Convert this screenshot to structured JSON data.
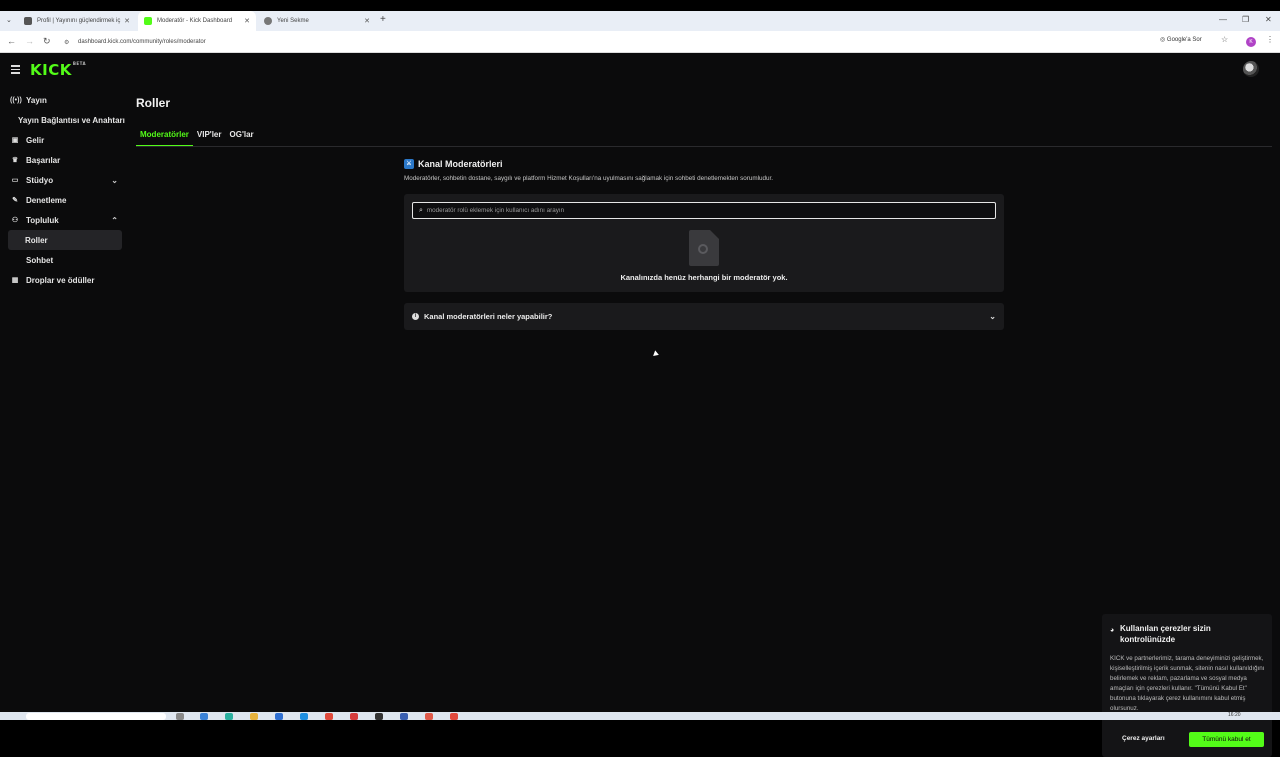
{
  "browser": {
    "tabs": [
      {
        "title": "Profil | Yayınını güçlendirmek iç",
        "fav_color": "#555555",
        "active": false
      },
      {
        "title": "Moderatör - Kick Dashboard",
        "fav_color": "#53fc18",
        "active": true
      },
      {
        "title": "Yeni Sekme",
        "fav_color": "#777777",
        "active": false
      }
    ],
    "url": "dashboard.kick.com/community/roles/moderator",
    "google_button": "Google'a Sor",
    "profile_initial": "K"
  },
  "app": {
    "logo": "KICK",
    "logo_badge": "BETA",
    "page_title": "Roller",
    "sidebar": [
      {
        "label": "Yayın",
        "icon": "broadcast-icon",
        "glyph": "((•))"
      },
      {
        "label": "Yayın Bağlantısı ve Anahtarı",
        "sub": true
      },
      {
        "label": "Gelir",
        "icon": "wallet-icon",
        "glyph": "▣"
      },
      {
        "label": "Başarılar",
        "icon": "trophy-icon",
        "glyph": "♛"
      },
      {
        "label": "Stüdyo",
        "icon": "studio-icon",
        "glyph": "▭",
        "chevron": "⌄"
      },
      {
        "label": "Denetleme",
        "icon": "wrench-icon",
        "glyph": "✎"
      },
      {
        "label": "Topluluk",
        "icon": "community-icon",
        "glyph": "⚇",
        "chevron": "⌃"
      },
      {
        "label": "Roller",
        "sub": true,
        "active": true
      },
      {
        "label": "Sohbet",
        "sub": true
      },
      {
        "label": "Droplar ve ödüller",
        "icon": "gift-icon",
        "glyph": "▦"
      }
    ],
    "tabs": [
      {
        "label": "Moderatörler",
        "active": true
      },
      {
        "label": "VIP'ler",
        "active": false
      },
      {
        "label": "OG'lar",
        "active": false
      }
    ],
    "section": {
      "title": "Kanal Moderatörleri",
      "description": "Moderatörler, sohbetin dostane, saygılı ve platform Hizmet Koşulları'na uyulmasını sağlamak için sohbeti denetlemekten sorumludur."
    },
    "search": {
      "placeholder": "moderatör rolü eklemek için kullanıcı adını arayın",
      "value": ""
    },
    "empty_state": "Kanalınızda henüz herhangi bir moderatör yok.",
    "accordion": "Kanal moderatörleri neler yapabilir?",
    "cookie": {
      "title": "Kullanılan çerezler sizin kontrolünüzde",
      "body": "KICK ve partnerlerimiz, tarama deneyiminizi geliştirmek, kişiselleştirilmiş içerik sunmak, sitenin nasıl kullanıldığını belirlemek ve reklam, pazarlama ve sosyal medya amaçları için çerezleri kullanır. \"Tümünü Kabul Et\" butonuna tıklayarak çerez kullanımını kabul etmiş olursunuz.",
      "settings_label": "Çerez ayarları",
      "accept_label": "Tümünü kabul et"
    }
  },
  "taskbar": {
    "clock": "16:20"
  },
  "colors": {
    "accent": "#53fc18",
    "background": "#0b0b0c",
    "card": "#1a1a1c"
  }
}
